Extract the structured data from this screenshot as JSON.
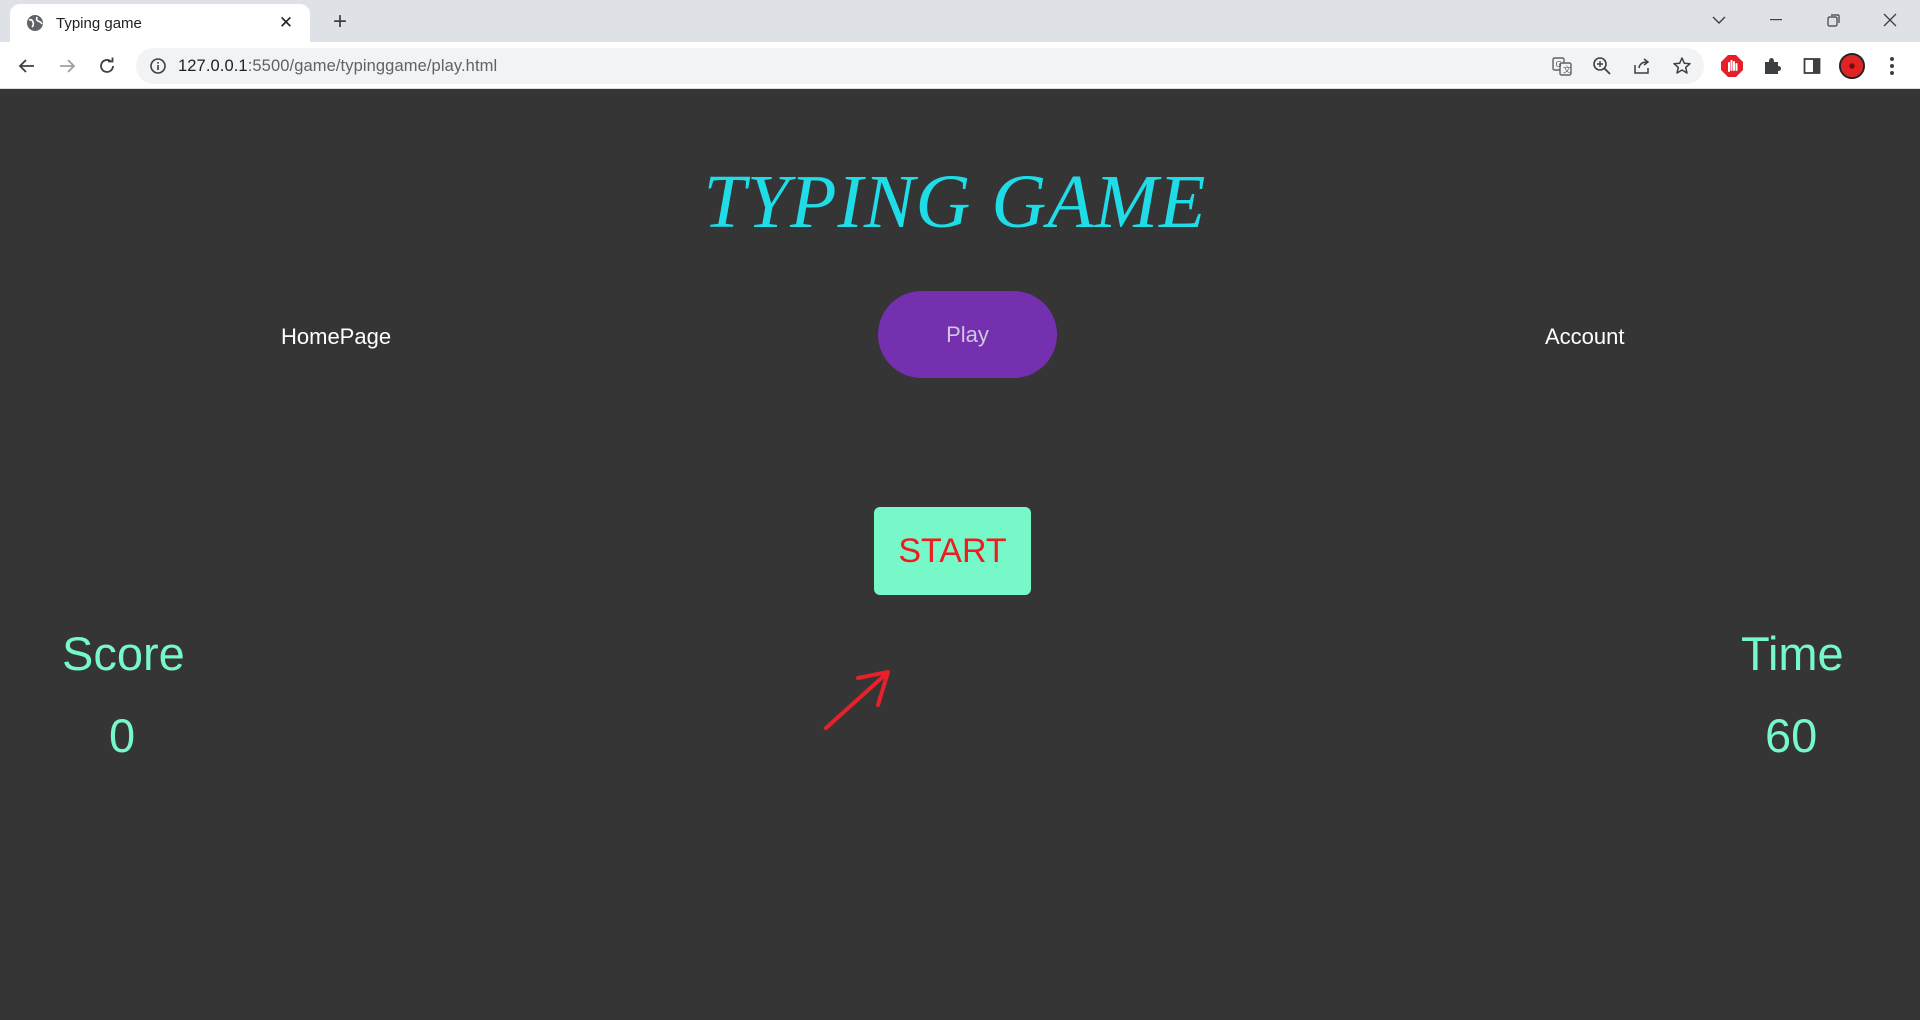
{
  "browser": {
    "tab_title": "Typing game",
    "tab_close": "✕",
    "new_tab": "+",
    "url_host": "127.0.0.1",
    "url_rest": ":5500/game/typinggame/play.html",
    "window_controls": [
      "chevron-down-icon",
      "minimize-icon",
      "restore-icon",
      "close-icon"
    ]
  },
  "page": {
    "title": "TYPING GAME",
    "nav": {
      "home": "HomePage",
      "play": "Play",
      "account": "Account"
    },
    "start_button": "START",
    "score": {
      "label": "Score",
      "value": "0"
    },
    "time": {
      "label": "Time",
      "value": "60"
    }
  },
  "colors": {
    "background": "#353535",
    "title": "#1fdce6",
    "play_pill": "#7530b0",
    "start_button": "#76f8c9",
    "start_text": "#ee1c1c",
    "stats": "#76f8c9",
    "arrow": "#e8202a"
  }
}
